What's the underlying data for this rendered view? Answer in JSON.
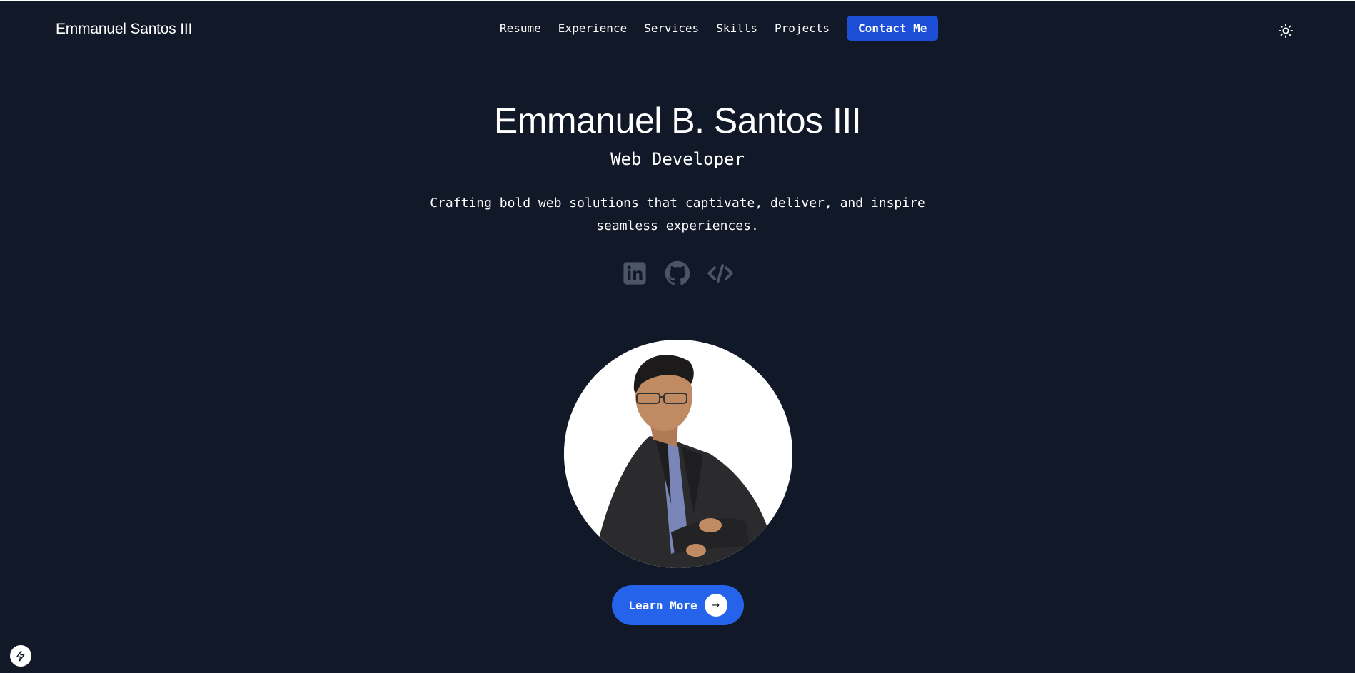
{
  "header": {
    "brand": "Emmanuel Santos III",
    "nav": [
      {
        "label": "Resume"
      },
      {
        "label": "Experience"
      },
      {
        "label": "Services"
      },
      {
        "label": "Skills"
      },
      {
        "label": "Projects"
      }
    ],
    "contact_label": "Contact Me",
    "theme_toggle_icon": "sun-icon"
  },
  "hero": {
    "name": "Emmanuel B. Santos III",
    "role": "Web Developer",
    "tagline": "Crafting bold web solutions that captivate, deliver, and inspire seamless experiences.",
    "socials": [
      {
        "icon": "linkedin-icon"
      },
      {
        "icon": "github-icon"
      },
      {
        "icon": "code-icon"
      }
    ],
    "cta_label": "Learn More",
    "cta_icon": "arrow-right-icon"
  },
  "colors": {
    "background": "#111827",
    "accent": "#1d4ed8",
    "cta": "#2563eb",
    "icon_muted": "#4b5563"
  }
}
